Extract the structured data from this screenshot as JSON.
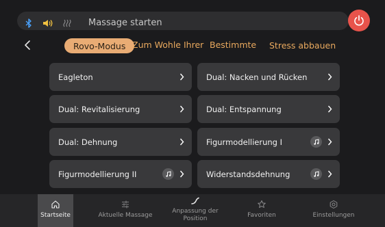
{
  "header": {
    "status_text": "Massage starten",
    "icons": [
      "bluetooth-icon",
      "speaker-icon",
      "heat-icon",
      "power-icon"
    ]
  },
  "tabs": [
    {
      "label": "Rovo-Modus",
      "active": true
    },
    {
      "label": "Zum Wohle Ihrer",
      "active": false
    },
    {
      "label": "Bestimmte",
      "active": false
    },
    {
      "label": "Stress abbauen",
      "active": false
    }
  ],
  "programs": [
    {
      "label": "Eagleton",
      "music": false
    },
    {
      "label": "Dual: Nacken und Rücken",
      "music": false
    },
    {
      "label": "Dual: Revitalisierung",
      "music": false
    },
    {
      "label": "Dual: Entspannung",
      "music": false
    },
    {
      "label": "Dual: Dehnung",
      "music": false
    },
    {
      "label": "Figurmodellierung I",
      "music": true
    },
    {
      "label": "Figurmodellierung II",
      "music": true
    },
    {
      "label": "Widerstandsdehnung",
      "music": true
    }
  ],
  "nav": [
    {
      "label": "Startseite",
      "icon": "home-icon",
      "active": true
    },
    {
      "label": "Aktuelle Massage",
      "icon": "sliders-icon",
      "active": false
    },
    {
      "label": "Anpassung der Position",
      "icon": "curve-icon",
      "active": false
    },
    {
      "label": "Favoriten",
      "icon": "star-icon",
      "active": false
    },
    {
      "label": "Einstellungen",
      "icon": "gear-icon",
      "active": false
    }
  ],
  "colors": {
    "accent": "#e9ac74",
    "tab_text": "#e9a95e",
    "power": "#e8534b",
    "bluetooth": "#4aa3ff",
    "speaker": "#f0c040"
  }
}
